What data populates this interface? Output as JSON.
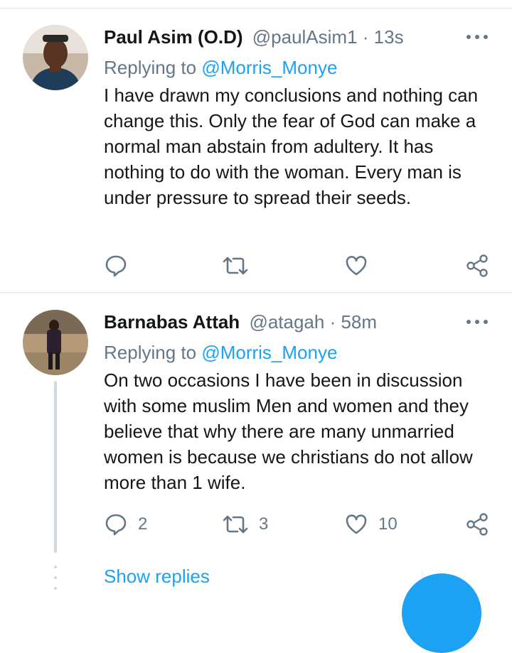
{
  "tweets": [
    {
      "name": "Paul Asim (O.D)",
      "handle": "@paulAsim1",
      "sep": " · ",
      "time": "13s",
      "replying_prefix": "Replying to ",
      "replying_handle": "@Morris_Monye",
      "text": "I have drawn my conclusions and nothing can change this. Only the fear of God can make a normal man abstain from adultery. It has nothing to do with the woman. Every man is under pressure to spread their seeds.",
      "reply_count": "",
      "retweet_count": "",
      "like_count": ""
    },
    {
      "name": "Barnabas Attah",
      "handle": "@atagah",
      "sep": " · ",
      "time": "58m",
      "replying_prefix": "Replying to ",
      "replying_handle": "@Morris_Monye",
      "text": "On two occasions I have been in discussion with some muslim Men and women and they believe that why there are many unmarried women is because we christians do not allow more than 1 wife.",
      "reply_count": "2",
      "retweet_count": "3",
      "like_count": "10"
    }
  ],
  "show_replies_label": "Show replies",
  "icons": {
    "reply": "reply-icon",
    "retweet": "retweet-icon",
    "like": "heart-icon",
    "share": "share-icon",
    "more": "more-icon"
  },
  "colors": {
    "accent": "#1da1f2",
    "muted": "#657786",
    "text": "#14171a",
    "divider": "#e1e8ed"
  }
}
